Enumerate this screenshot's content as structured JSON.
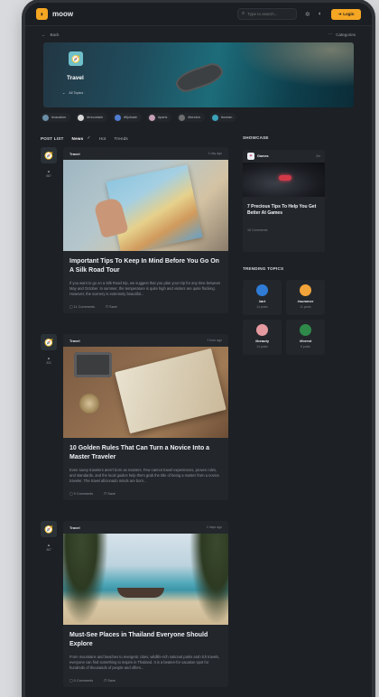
{
  "header": {
    "brand": "moow",
    "search_placeholder": "Type to search...",
    "login_label": "Login",
    "icons": [
      "search-icon",
      "settings-icon",
      "moon-icon",
      "login-icon"
    ]
  },
  "subnav": {
    "back_label": "Back",
    "categories_label": "Categories"
  },
  "hero": {
    "icon": "🧭",
    "title": "Travel",
    "sub": "All Topics"
  },
  "chips": [
    {
      "label": "#vacation",
      "color": "#6b8fa7"
    },
    {
      "label": "#mountain",
      "color": "#d8d8d8"
    },
    {
      "label": "#fly4sale",
      "color": "#4f7dd1"
    },
    {
      "label": "#paris",
      "color": "#c79fb6"
    },
    {
      "label": "#london",
      "color": "#6e6e6e"
    },
    {
      "label": "#ocean",
      "color": "#3aa3b8"
    }
  ],
  "post_list": {
    "label": "POST LIST",
    "tabs": [
      "News",
      "Hot",
      "Trends"
    ]
  },
  "posts": [
    {
      "category": "Travel",
      "time": "1 day ago",
      "votes": "587",
      "title": "Important Tips To Keep In Mind Before You Go On A Silk Road Tour",
      "body": "If you want to go on a Silk Road trip, we suggest that you plan your trip for any time between May and October. In summer, the temperature is quite high and visitors are quite flocking. However, the scenery is extremely beautiful...",
      "comments": "11 Comments",
      "save": "Save"
    },
    {
      "category": "Travel",
      "time": "1 hour ago",
      "votes": "331",
      "title": "10 Golden Rules That Can Turn a Novice Into a Master Traveler",
      "body": "Even savvy travelers aren't born as masters. Few cannot travel experiences, proven rules, and standards, and the local guides help them grab the title of being a master from a novice traveler. The travel aficionado minds are born...",
      "comments": "9 Comments",
      "save": "Save"
    },
    {
      "category": "Travel",
      "time": "2 days ago",
      "votes": "367",
      "title": "Must-See Places in Thailand Everyone Should Explore",
      "body": "From mountains and beaches to energetic cities, wildlife-rich national parks and rich travels, everyone can find something to inspire in Thailand. It is a beaten-for vacation spot for hundreds of thousands of people and offers...",
      "comments": "0 Comments",
      "save": "Save"
    }
  ],
  "showcase": {
    "label": "SHOWCASE",
    "author": "Games",
    "time": "2hr",
    "title": "7 Precious Tips To Help You Get Better At Games",
    "meta": "16 Comments"
  },
  "trending": {
    "label": "TRENDING TOPICS",
    "topics": [
      {
        "name": "#art",
        "posts": "14 posts",
        "color": "#2f7bd6"
      },
      {
        "name": "#summer",
        "posts": "11 posts",
        "color": "#f2a33a"
      },
      {
        "name": "#beauty",
        "posts": "14 posts",
        "color": "#e59aa0"
      },
      {
        "name": "#forest",
        "posts": "8 posts",
        "color": "#2f8a4a"
      }
    ]
  }
}
